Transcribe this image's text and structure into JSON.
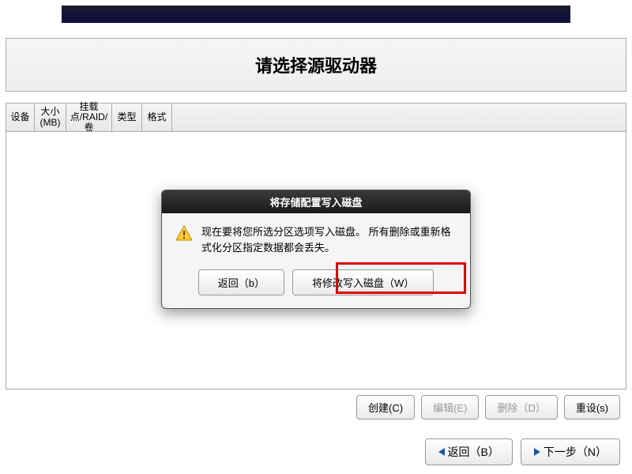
{
  "header": {
    "title": "请选择源驱动器"
  },
  "table": {
    "headers": [
      "设备",
      "大小(MB)",
      "挂载点/RAID/卷",
      "类型",
      "格式"
    ]
  },
  "modal": {
    "title": "将存储配置写入磁盘",
    "message": "现在要将您所选分区选项写入磁盘。 所有删除或重新格式化分区指定数据都会丢失。",
    "back_label": "返回（b）",
    "write_label": "将修改写入磁盘（W）"
  },
  "actions": {
    "create": "创建(C)",
    "edit": "编辑(E)",
    "delete": "删除（D）",
    "reset": "重设(s)"
  },
  "nav": {
    "back": "返回（B）",
    "next": "下一步（N）"
  }
}
